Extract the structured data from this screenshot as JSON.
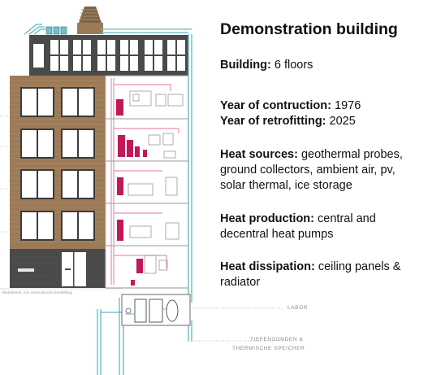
{
  "title": "Demonstration building",
  "facts": {
    "building": {
      "label": "Building:",
      "value": "6 floors"
    },
    "construction_year": {
      "label": "Year of contruction:",
      "value": "1976"
    },
    "retrofit_year": {
      "label": "Year of retrofitting:",
      "value": "2025"
    },
    "heat_sources": {
      "label": "Heat sources:",
      "value_line1": "geothermal probes,",
      "line2": "ground collectors, ambient air, pv,",
      "line3": "solar thermal, ice storage"
    },
    "heat_production": {
      "label": "Heat production:",
      "value_line1": "central and",
      "line2": "decentral heat pumps"
    },
    "heat_dissipation": {
      "label": "Heat dissipation:",
      "value_line1": "ceiling panels &",
      "line2": "radiator"
    }
  },
  "diagram": {
    "caption_left": "Abstrahierte, rein schematische Darstellung",
    "label_labor": "LABOR",
    "label_probes_line1": "TIEFENSONDEN &",
    "label_probes_line2": "THERMISCHE SPEICHER"
  },
  "colors": {
    "magenta": "#c2185b",
    "pink_pipe": "#e78fb3",
    "teal": "#5fb7c5",
    "brick": "#9c7a58",
    "dark_slate": "#4a4a4a",
    "window_white": "#ffffff"
  }
}
